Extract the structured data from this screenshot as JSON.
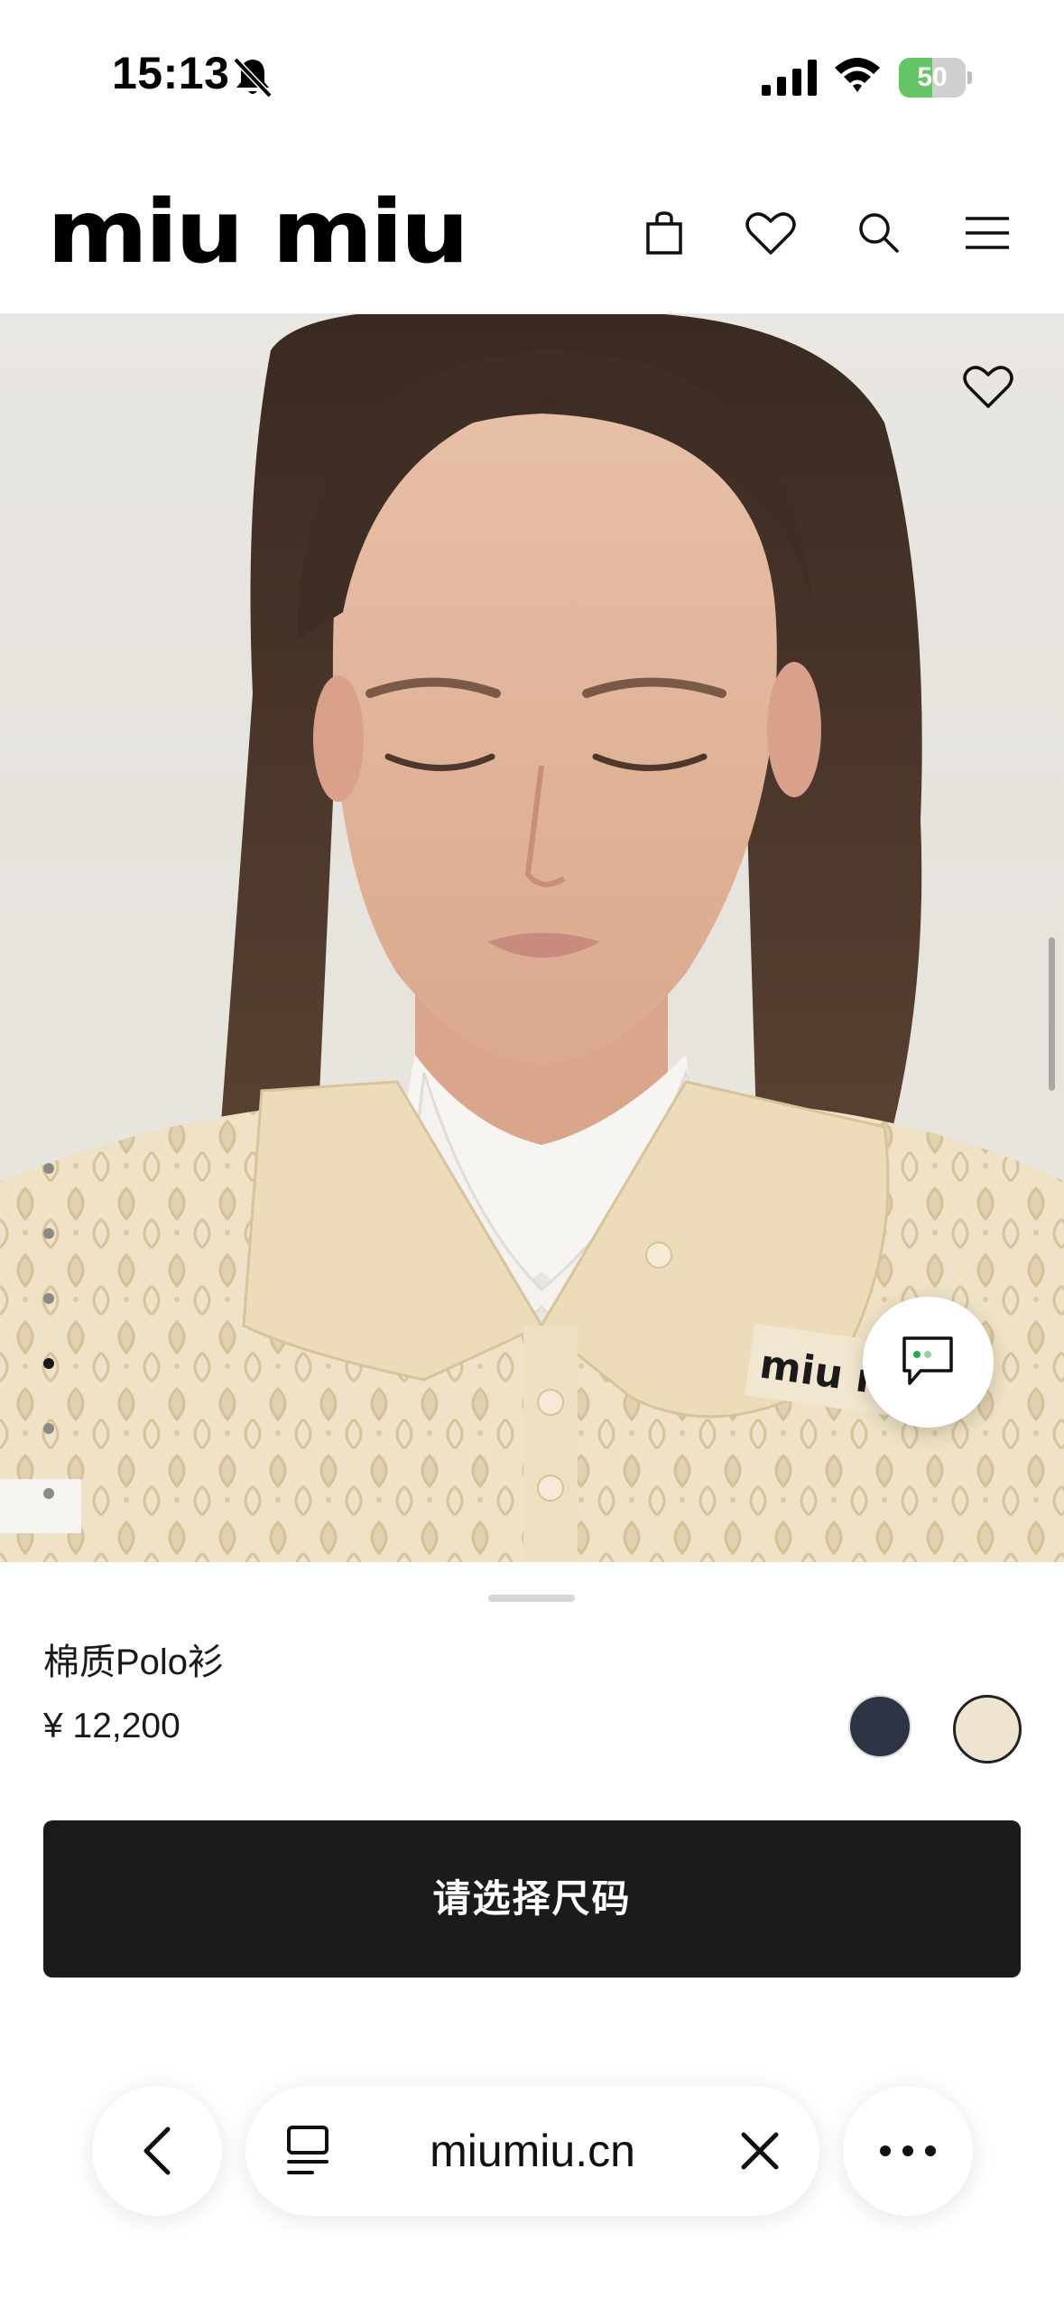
{
  "status_bar": {
    "time": "15:13",
    "battery_level": "50",
    "battery_fraction": 0.5,
    "battery_color": "#65c466"
  },
  "header": {
    "brand": "miu miu",
    "icons": [
      "shopping-bag-icon",
      "heart-icon",
      "search-icon",
      "menu-icon"
    ]
  },
  "gallery": {
    "image_count": 6,
    "active_index": 3,
    "favorite_icon": "heart-icon",
    "chat_icon": "chat-bubble-icon"
  },
  "product": {
    "name": "棉质Polo衫",
    "price": "¥ 12,200",
    "swatches": [
      {
        "color": "#2d3446",
        "selected": false
      },
      {
        "color": "#eee4d0",
        "selected": true
      }
    ],
    "cta_label": "请选择尺码",
    "cta_color": "#1b1b1c"
  },
  "browser": {
    "url": "miumiu.cn",
    "icons": [
      "back-chevron-icon",
      "reader-icon",
      "close-icon",
      "more-icon"
    ]
  }
}
